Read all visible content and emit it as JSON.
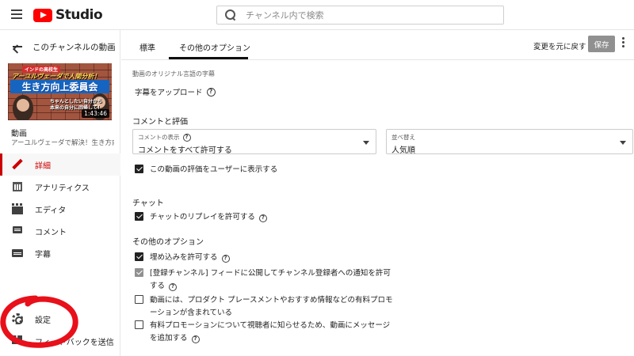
{
  "header": {
    "logo_text": "Studio",
    "search_placeholder": "チャンネル内で検索"
  },
  "sidebar": {
    "back_title": "このチャンネルの動画",
    "thumbnail": {
      "top_text": "インドの高校生",
      "line2": "アーユルヴェーダで人間分析！",
      "banner": "生き方向上委員会",
      "sub_line1": "ちゃんとしたい自分から",
      "sub_line2": "本来の自分に回帰して！",
      "duration": "1:43:46"
    },
    "video_label": "動画",
    "video_title": "アーユルヴェーダで解決！生き方向...",
    "items": [
      {
        "label": "詳細",
        "icon": "pencil-icon",
        "active": true
      },
      {
        "label": "アナリティクス",
        "icon": "analytics-icon",
        "active": false
      },
      {
        "label": "エディタ",
        "icon": "editor-icon",
        "active": false
      },
      {
        "label": "コメント",
        "icon": "comment-icon",
        "active": false
      },
      {
        "label": "字幕",
        "icon": "subtitles-icon",
        "active": false
      }
    ],
    "settings_label": "設定",
    "feedback_label": "フィードバックを送信"
  },
  "topbar": {
    "tab_standard": "標準",
    "tab_other": "その他のオプション",
    "undo_label": "変更を元に戻す",
    "save_label": "保存"
  },
  "main": {
    "caption_label": "動画のオリジナル言語の字幕",
    "upload_label": "字幕をアップロード",
    "comments_section": "コメントと評価",
    "comment_visibility": {
      "caption": "コメントの表示",
      "value": "コメントをすべて許可する"
    },
    "sort_by": {
      "caption": "並べ替え",
      "value": "人気順"
    },
    "show_ratings_label": "この動画の評価をユーザーに表示する",
    "chat_section": "チャット",
    "chat_replay_label": "チャットのリプレイを許可する",
    "other_section": "その他のオプション",
    "embed_label": "埋め込みを許可する",
    "subscription_label_1": "[登録チャンネル] フィードに公開してチャンネル登録者への通知を許可",
    "subscription_label_2": "する",
    "paid_promo_label_1": "動画には、プロダクト プレースメントやおすすめ情報などの有料プロモ",
    "paid_promo_label_2": "ーションが含まれている",
    "promo_message_label_1": "有料プロモーションについて視聴者に知らせるため、動画にメッセージ",
    "promo_message_label_2": "を追加する"
  },
  "colors": {
    "accent": "#cc0000",
    "annotation": "#e8101a"
  }
}
